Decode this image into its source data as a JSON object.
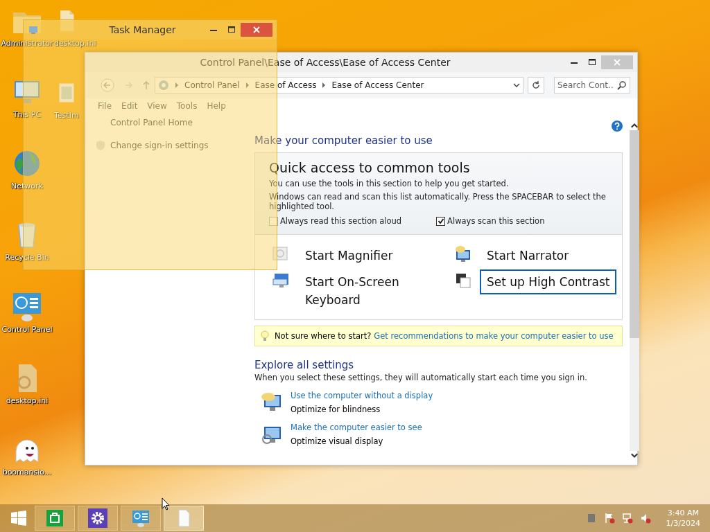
{
  "desktop": {
    "columns": [
      [
        {
          "label": "Administrator",
          "kind": "folder"
        },
        {
          "label": "This PC",
          "kind": "pc"
        },
        {
          "label": "Network",
          "kind": "globe"
        },
        {
          "label": "Recycle Bin",
          "kind": "bin"
        },
        {
          "label": "Control Panel",
          "kind": "cpanel"
        },
        {
          "label": "desktop.ini",
          "kind": "config"
        },
        {
          "label": "boomansio...",
          "kind": "ghost"
        }
      ],
      [
        {
          "label": "desktop.ini",
          "kind": "file"
        },
        {
          "label": "TestIm",
          "kind": "image"
        }
      ]
    ]
  },
  "task_manager": {
    "title": "Task Manager"
  },
  "control_panel": {
    "title": "Control Panel\\Ease of Access\\Ease of Access Center",
    "breadcrumb": [
      "Control Panel",
      "Ease of Access",
      "Ease of Access Center"
    ],
    "search": {
      "placeholder": "Search Cont..."
    },
    "menu": [
      "File",
      "Edit",
      "View",
      "Tools",
      "Help"
    ],
    "sidebar": [
      {
        "label": "Control Panel Home",
        "kind": "plain"
      },
      {
        "label": "Change sign-in settings",
        "kind": "shield"
      }
    ],
    "heading": "Make your computer easier to use",
    "quick_access": {
      "title": "Quick access to common tools",
      "lines": [
        "You can use the tools in this section to help you get started.",
        "Windows can read and scan this list automatically.  Press the SPACEBAR to select the highlighted tool."
      ],
      "checkboxes": [
        {
          "label": "Always read this section aloud",
          "checked": false
        },
        {
          "label": "Always scan this section",
          "checked": true
        }
      ],
      "tools": [
        {
          "label": "Start Magnifier",
          "kind": "magnifier",
          "selected": false
        },
        {
          "label": "Start Narrator",
          "kind": "narrator",
          "selected": false
        },
        {
          "label": "Start On-Screen Keyboard",
          "kind": "keyboard",
          "selected": false
        },
        {
          "label": "Set up High Contrast",
          "kind": "contrast",
          "selected": true
        }
      ]
    },
    "tip": {
      "text": "Not sure where to start?",
      "link": "Get recommendations to make your computer easier to use"
    },
    "explore": {
      "title": "Explore all settings",
      "description": "When you select these settings, they will automatically start each time you sign in.",
      "items": [
        {
          "link": "Use the computer without a display",
          "description": "Optimize for blindness"
        },
        {
          "link": "Make the computer easier to see",
          "description": "Optimize visual display"
        }
      ]
    }
  },
  "taskbar": {
    "apps": [
      {
        "kind": "store",
        "active": false
      },
      {
        "kind": "settings",
        "active": false
      },
      {
        "kind": "cpanel",
        "active": false
      },
      {
        "kind": "file",
        "active": true
      }
    ],
    "clock": {
      "time": "3:40 AM",
      "date": "1/3/2024"
    }
  }
}
